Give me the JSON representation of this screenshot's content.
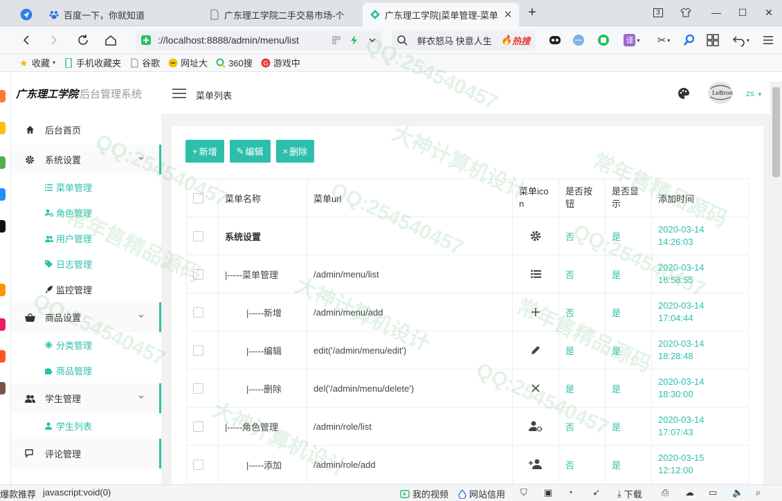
{
  "browser": {
    "tabs": [
      {
        "label": "百度一下，你就知道"
      },
      {
        "label": "广东理工学院二手交易市场-个"
      },
      {
        "label": "广东理工学院|菜单管理-菜单"
      }
    ],
    "tab_count": "3",
    "url": "://localhost:8888/admin/menu/list",
    "search_text": "鲜衣怒马 快意人生",
    "hot_label": "热搜",
    "bookmarks": [
      "收藏",
      "手机收藏夹",
      "谷歌",
      "网址大",
      "360搜",
      "游戏中"
    ]
  },
  "app": {
    "logo_bold": "广东理工学院",
    "logo_rest": "后台管理系统",
    "page_title": "菜单列表",
    "username": "zs",
    "avatar_text": "LeBron"
  },
  "sidebar": {
    "home": "后台首页",
    "system": "系统设置",
    "system_items": [
      "菜单管理",
      "角色管理",
      "用户管理",
      "日志管理",
      "监控管理"
    ],
    "goods": "商品设置",
    "goods_items": [
      "分类管理",
      "商品管理"
    ],
    "student": "学生管理",
    "student_items": [
      "学生列表"
    ],
    "comment": "评论管理"
  },
  "toolbar": {
    "add": "新增",
    "edit": "编辑",
    "delete": "删除"
  },
  "table": {
    "headers": [
      "菜单名称",
      "菜单url",
      "菜单icon",
      "是否按钮",
      "是否显示",
      "添加时间"
    ],
    "rows": [
      {
        "name": "系统设置",
        "url": "",
        "icon": "gear-icon",
        "is_button": "否",
        "visible": "是",
        "date": "2020-03-14",
        "time": "14:26:03"
      },
      {
        "name": "|-----菜单管理",
        "url": "/admin/menu/list",
        "icon": "list-icon",
        "is_button": "否",
        "visible": "是",
        "date": "2020-03-14",
        "time": "16:58:55"
      },
      {
        "name": "|-----新增",
        "url": "/admin/menu/add",
        "icon": "plus-icon",
        "is_button": "否",
        "visible": "是",
        "date": "2020-03-14",
        "time": "17:04:44"
      },
      {
        "name": "|-----编辑",
        "url": "edit('/admin/menu/edit')",
        "icon": "pencil-icon",
        "is_button": "是",
        "visible": "是",
        "date": "2020-03-14",
        "time": "18:28:48"
      },
      {
        "name": "|-----删除",
        "url": "del('/admin/menu/delete')",
        "icon": "close-icon",
        "is_button": "是",
        "visible": "是",
        "date": "2020-03-14",
        "time": "18:30:00"
      },
      {
        "name": "|-----角色管理",
        "url": "/admin/role/list",
        "icon": "user-gear-icon",
        "is_button": "否",
        "visible": "是",
        "date": "2020-03-14",
        "time": "17:07:43"
      },
      {
        "name": "|-----添加",
        "url": "/admin/role/add",
        "icon": "user-plus-icon",
        "is_button": "否",
        "visible": "是",
        "date": "2020-03-15",
        "time": "12:12:00"
      }
    ]
  },
  "statusbar": {
    "left": "爆款推荐",
    "link": "javascript:void(0)",
    "video": "我的视频",
    "credit": "网站信用",
    "download": "下载"
  },
  "watermarks": [
    "QQ:254540457",
    "大神计算机设计",
    "常年售精品源码"
  ],
  "accent_color": "#2dbfab"
}
